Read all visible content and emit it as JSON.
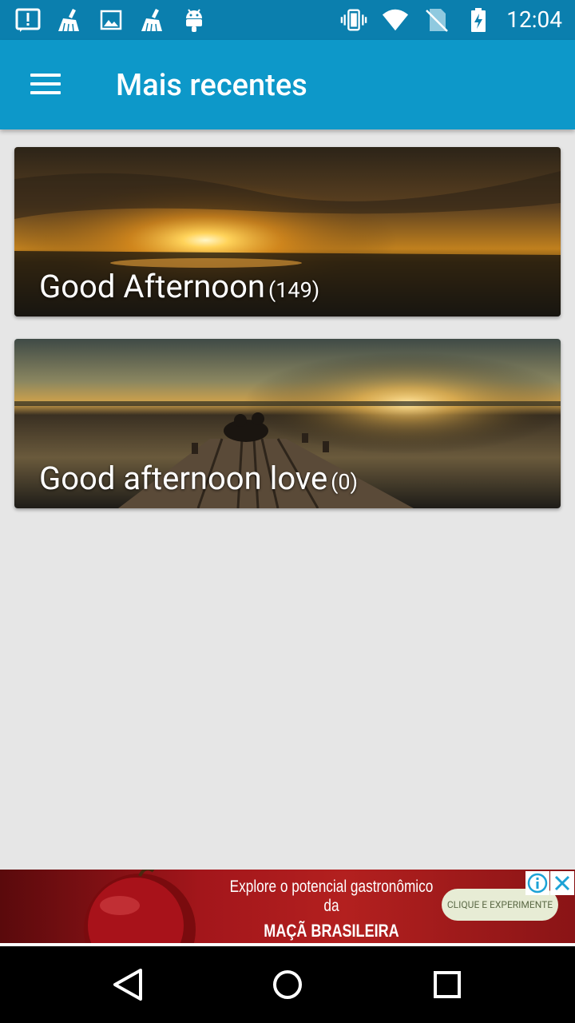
{
  "status_bar": {
    "time": "12:04",
    "left_icons": [
      "alert-icon",
      "cleaner-icon",
      "image-icon",
      "cleaner-icon",
      "android-icon"
    ],
    "right_icons": [
      "vibrate-icon",
      "wifi-icon",
      "no-sim-icon",
      "battery-charging-icon"
    ]
  },
  "app_bar": {
    "title": "Mais recentes",
    "background": "#0d98c9"
  },
  "categories": [
    {
      "title": "Good Afternoon",
      "count": "(149)"
    },
    {
      "title": "Good afternoon love",
      "count": "(0)"
    }
  ],
  "ad": {
    "line1": "Explore o potencial gastronômico da",
    "line2": "MAÇÃ BRASILEIRA",
    "cta": "CLIQUE E EXPERIMENTE"
  },
  "nav_bar": {
    "buttons": [
      "back-icon",
      "home-icon",
      "recents-icon"
    ]
  }
}
